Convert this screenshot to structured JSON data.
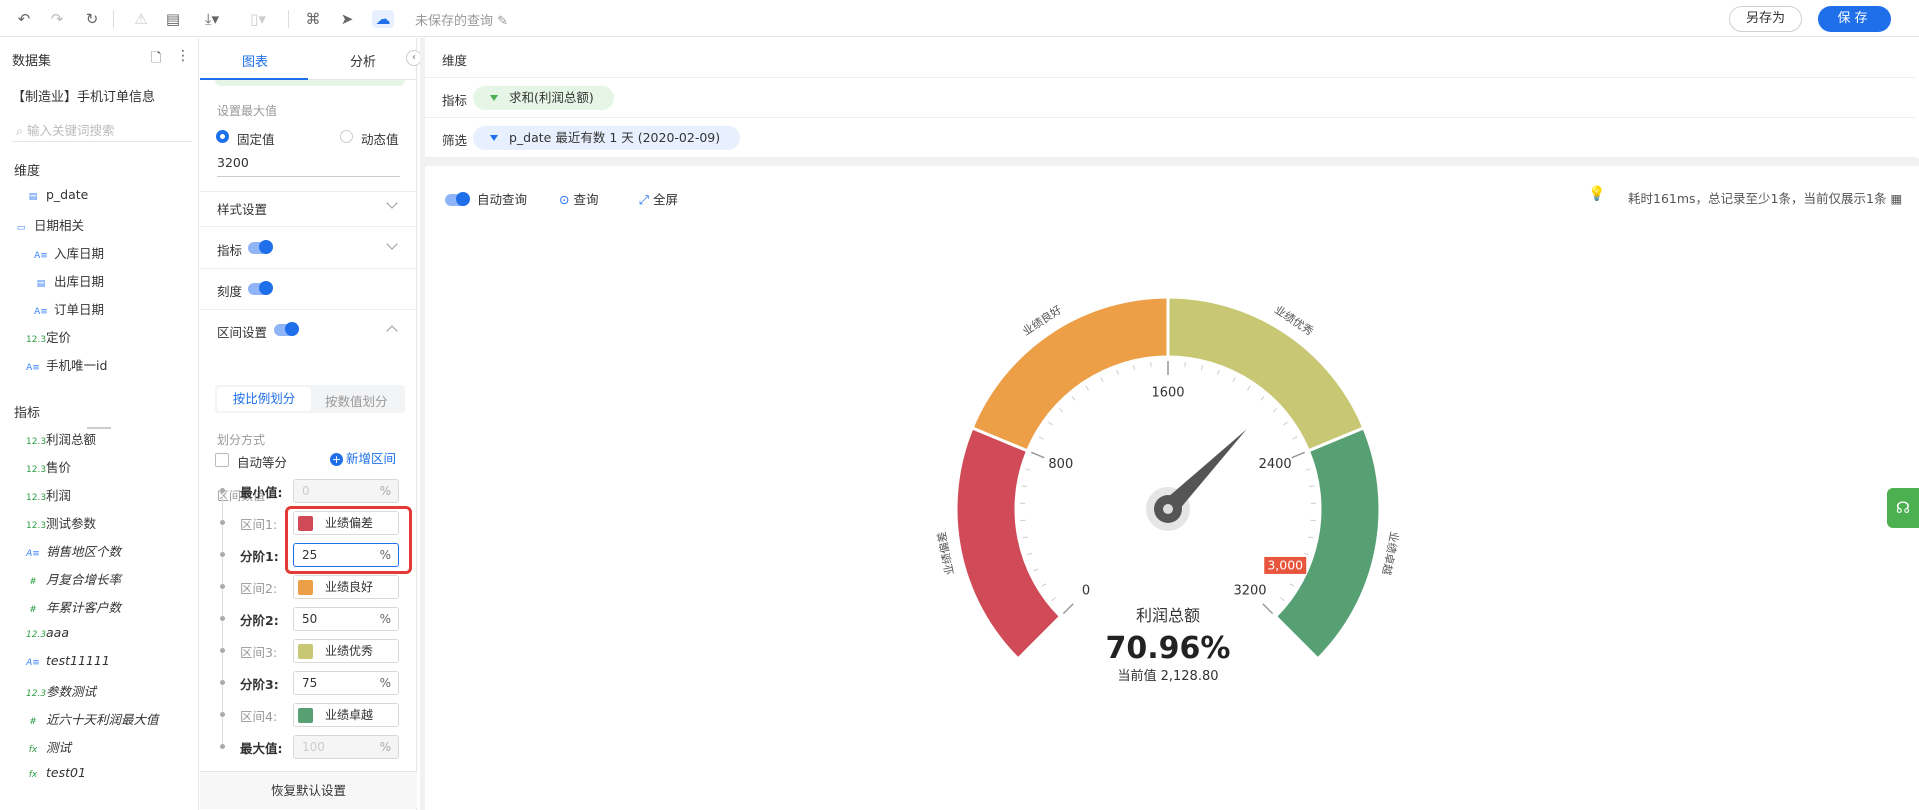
{
  "toolbar": {
    "unsaved": "未保存的查询",
    "save_as": "另存为",
    "save": "保存"
  },
  "dataset": {
    "title": "数据集",
    "name": "【制造业】手机订单信息",
    "search_placeholder": "输入关键词搜索",
    "dimensions_title": "维度",
    "dimensions": [
      {
        "label": "p_date",
        "type": "date"
      },
      {
        "label": "日期相关",
        "type": "folder"
      },
      {
        "label": "入库日期",
        "type": "text"
      },
      {
        "label": "出库日期",
        "type": "date"
      },
      {
        "label": "订单日期",
        "type": "text"
      },
      {
        "label": "定价",
        "type": "num"
      },
      {
        "label": "手机唯一id",
        "type": "text"
      }
    ],
    "metrics_title": "指标",
    "metrics": [
      {
        "label": "利润总额",
        "type": "num"
      },
      {
        "label": "售价",
        "type": "num"
      },
      {
        "label": "利润",
        "type": "num"
      },
      {
        "label": "测试参数",
        "type": "num"
      },
      {
        "label": "销售地区个数",
        "type": "text"
      },
      {
        "label": "月复合增长率",
        "type": "hash"
      },
      {
        "label": "年累计客户数",
        "type": "hash"
      },
      {
        "label": "aaa",
        "type": "num"
      },
      {
        "label": "test11111",
        "type": "text"
      },
      {
        "label": "参数测试",
        "type": "num"
      },
      {
        "label": "近六十天利润最大值",
        "type": "hash"
      },
      {
        "label": "测试",
        "type": "fx"
      },
      {
        "label": "test01",
        "type": "fx"
      }
    ]
  },
  "config": {
    "tab_chart": "图表",
    "tab_analysis": "分析",
    "max_title": "设置最大值",
    "fixed": "固定值",
    "dynamic": "动态值",
    "max_value": "3200",
    "style_settings": "样式设置",
    "metric": "指标",
    "scale": "刻度",
    "interval_settings": "区间设置",
    "by_ratio": "按比例划分",
    "by_value": "按数值划分",
    "split_method": "划分方式",
    "auto_equal": "自动等分",
    "interval_values": "区间数值",
    "add_interval": "新增区间",
    "min_label": "最小值:",
    "min_placeholder": "0",
    "max_label": "最大值:",
    "max_placeholder": "100",
    "pct": "%",
    "intervals": [
      {
        "label": "区间1:",
        "name": "业绩偏差",
        "color": "#d04b57"
      },
      {
        "label": "区间2:",
        "name": "业绩良好",
        "color": "#ec9f46"
      },
      {
        "label": "区间3:",
        "name": "业绩优秀",
        "color": "#c8c874"
      },
      {
        "label": "区间4:",
        "name": "业绩卓越",
        "color": "#57a074"
      }
    ],
    "steps": [
      {
        "label": "分阶1:",
        "value": "25"
      },
      {
        "label": "分阶2:",
        "value": "50"
      },
      {
        "label": "分阶3:",
        "value": "75"
      }
    ],
    "restore": "恢复默认设置"
  },
  "query": {
    "dimension": "维度",
    "metric": "指标",
    "metric_pill": "求和(利润总额)",
    "filter": "筛选",
    "filter_pill": "p_date 最近有数 1 天 (2020-02-09)"
  },
  "run": {
    "auto_query": "自动查询",
    "query": "查询",
    "fullscreen": "全屏",
    "info": "耗时161ms，总记录至少1条，当前仅展示1条"
  },
  "chart_data": {
    "type": "gauge",
    "min": 0,
    "max": 3200,
    "value": 2128.8,
    "ticks": [
      "0",
      "800",
      "1600",
      "2400",
      "3200"
    ],
    "marker": "3,000",
    "bands": [
      {
        "name": "业绩偏差",
        "from": 0,
        "to": 800,
        "color": "#d04b57"
      },
      {
        "name": "业绩良好",
        "from": 800,
        "to": 1600,
        "color": "#ec9f46"
      },
      {
        "name": "业绩优秀",
        "from": 1600,
        "to": 2400,
        "color": "#c8c874"
      },
      {
        "name": "业绩卓越",
        "from": 2400,
        "to": 3200,
        "color": "#57a074"
      }
    ],
    "metric_name": "利润总额",
    "percent": "70.96%",
    "current_label": "当前值 2,128.80"
  }
}
